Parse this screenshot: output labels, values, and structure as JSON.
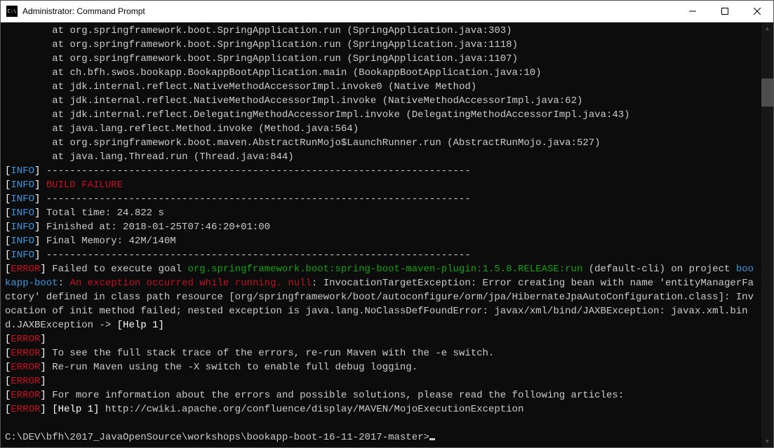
{
  "window": {
    "title": "Administrator: Command Prompt"
  },
  "stack": [
    {
      "at": "at",
      "loc": "org.springframework.boot.SpringApplication.run",
      "paren": "(SpringApplication.java:303)"
    },
    {
      "at": "at",
      "loc": "org.springframework.boot.SpringApplication.run",
      "paren": "(SpringApplication.java:1118)"
    },
    {
      "at": "at",
      "loc": "org.springframework.boot.SpringApplication.run",
      "paren": "(SpringApplication.java:1107)"
    },
    {
      "at": "at",
      "loc": "ch.bfh.swos.bookapp.BookappBootApplication.main",
      "paren": "(BookappBootApplication.java:10)"
    },
    {
      "at": "at",
      "loc": "jdk.internal.reflect.NativeMethodAccessorImpl.invoke0",
      "paren": "(Native Method)"
    },
    {
      "at": "at",
      "loc": "jdk.internal.reflect.NativeMethodAccessorImpl.invoke",
      "paren": "(NativeMethodAccessorImpl.java:62)"
    },
    {
      "at": "at",
      "loc": "jdk.internal.reflect.DelegatingMethodAccessorImpl.invoke",
      "paren": "(DelegatingMethodAccessorImpl.java:43)"
    },
    {
      "at": "at",
      "loc": "java.lang.reflect.Method.invoke",
      "paren": "(Method.java:564)"
    },
    {
      "at": "at",
      "loc": "org.springframework.boot.maven.AbstractRunMojo$LaunchRunner.run",
      "paren": "(AbstractRunMojo.java:527)"
    },
    {
      "at": "at",
      "loc": "java.lang.Thread.run",
      "paren": "(Thread.java:844)"
    }
  ],
  "tags": {
    "lb": "[",
    "rb": "]",
    "info": "INFO",
    "error": "ERROR"
  },
  "rule": " ------------------------------------------------------------------------",
  "build_failure": " BUILD FAILURE",
  "summary": {
    "total": " Total time: 24.822 s",
    "finished": " Finished at: 2018-01-25T07:46:20+01:00",
    "memory": " Final Memory: 42M/140M"
  },
  "err": {
    "l1a": " Failed to execute goal ",
    "l1b": "org.springframework.boot:spring-boot-maven-plugin:1.5.8.RELEASE:run",
    "l1c": " (default-cli) on project ",
    "l1d": "bookapp-boot",
    "l1e": ": ",
    "l1f": "An exception occurred while running. null",
    "l1g": ": InvocationTargetException: Error creating bean with name 'entityManagerFactory' defined in class path resource [org/springframework/boot/autoconfigure/orm/jpa/HibernateJpaAutoConfiguration.class]: Invocation of init method failed; nested exception is java.lang.NoClassDefFoundError: javax/xml/bind/JAXBException: javax.xml.bind.JAXBException -> ",
    "help1_inline": "[Help 1]",
    "l2": " To see the full stack trace of the errors, re-run Maven with the -e switch.",
    "l3": " Re-run Maven using the -X switch to enable full debug logging.",
    "l4": " For more information about the errors and possible solutions, please read the following articles:",
    "help_label": " [Help 1] ",
    "help_url": "http://cwiki.apache.org/confluence/display/MAVEN/MojoExecutionException"
  },
  "prompt": "C:\\DEV\\bfh\\2017_JavaOpenSource\\workshops\\bookapp-boot-16-11-2017-master>"
}
